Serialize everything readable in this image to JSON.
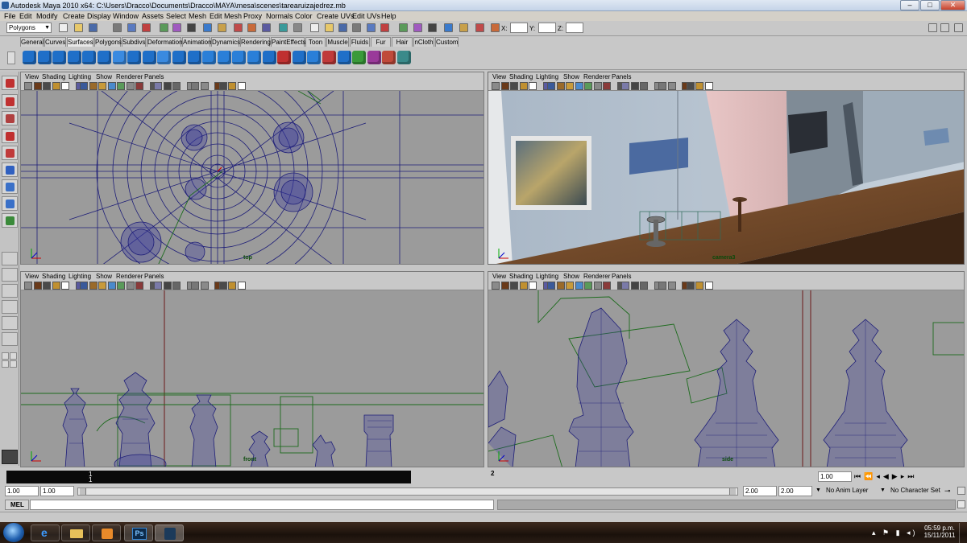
{
  "window": {
    "title": "Autodesk Maya 2010 x64: C:\\Users\\Dracco\\Documents\\Dracco\\MAYA\\mesa\\scenes\\tarearuizajedrez.mb",
    "min_label": "–",
    "max_label": "□",
    "close_label": "✕"
  },
  "menus": [
    "File",
    "Edit",
    "Modify",
    "Create",
    "Display",
    "Window",
    "Assets",
    "Select",
    "Mesh",
    "Edit Mesh",
    "Proxy",
    "Normals",
    "Color",
    "Create UVs",
    "Edit UVs",
    "Help"
  ],
  "status_line": {
    "mode": "Polygons",
    "coord_labels": [
      "X:",
      "Y:",
      "Z:"
    ],
    "coord_values": [
      "",
      "",
      ""
    ]
  },
  "shelf_tabs": [
    "General",
    "Curves",
    "Surfaces",
    "Polygons",
    "Subdivs",
    "Deformation",
    "Animation",
    "Dynamics",
    "Rendering",
    "PaintEffects",
    "Toon",
    "Muscle",
    "Fluids",
    "Fur",
    "Hair",
    "nCloth",
    "Custom"
  ],
  "shelf_active": "Surfaces",
  "panel_menu": [
    "View",
    "Shading",
    "Lighting",
    "Show",
    "Renderer",
    "Panels"
  ],
  "viewports": {
    "top": {
      "camera": "top"
    },
    "persp": {
      "camera": "camera3"
    },
    "front": {
      "camera": "front"
    },
    "side": {
      "camera": "side"
    }
  },
  "time_slider": {
    "ticks": [
      "1",
      "2"
    ],
    "current_time": "1.00"
  },
  "range_slider": {
    "start_time": "1.00",
    "playback_start": "1.00",
    "playback_end": "2.00",
    "end_time": "2.00",
    "anim_layer": "No Anim Layer",
    "character_set": "No Character Set"
  },
  "command_line": {
    "label": "MEL",
    "value": ""
  },
  "taskbar": {
    "time": "05:59 p.m.",
    "date": "15/11/2011",
    "ps_label": "Ps"
  },
  "colors": {
    "wire_blue": "#1e1e78",
    "wire_green": "#1d6b1d",
    "viewport_gray": "#9b9b9b",
    "ui_gray": "#c8c8c8"
  }
}
